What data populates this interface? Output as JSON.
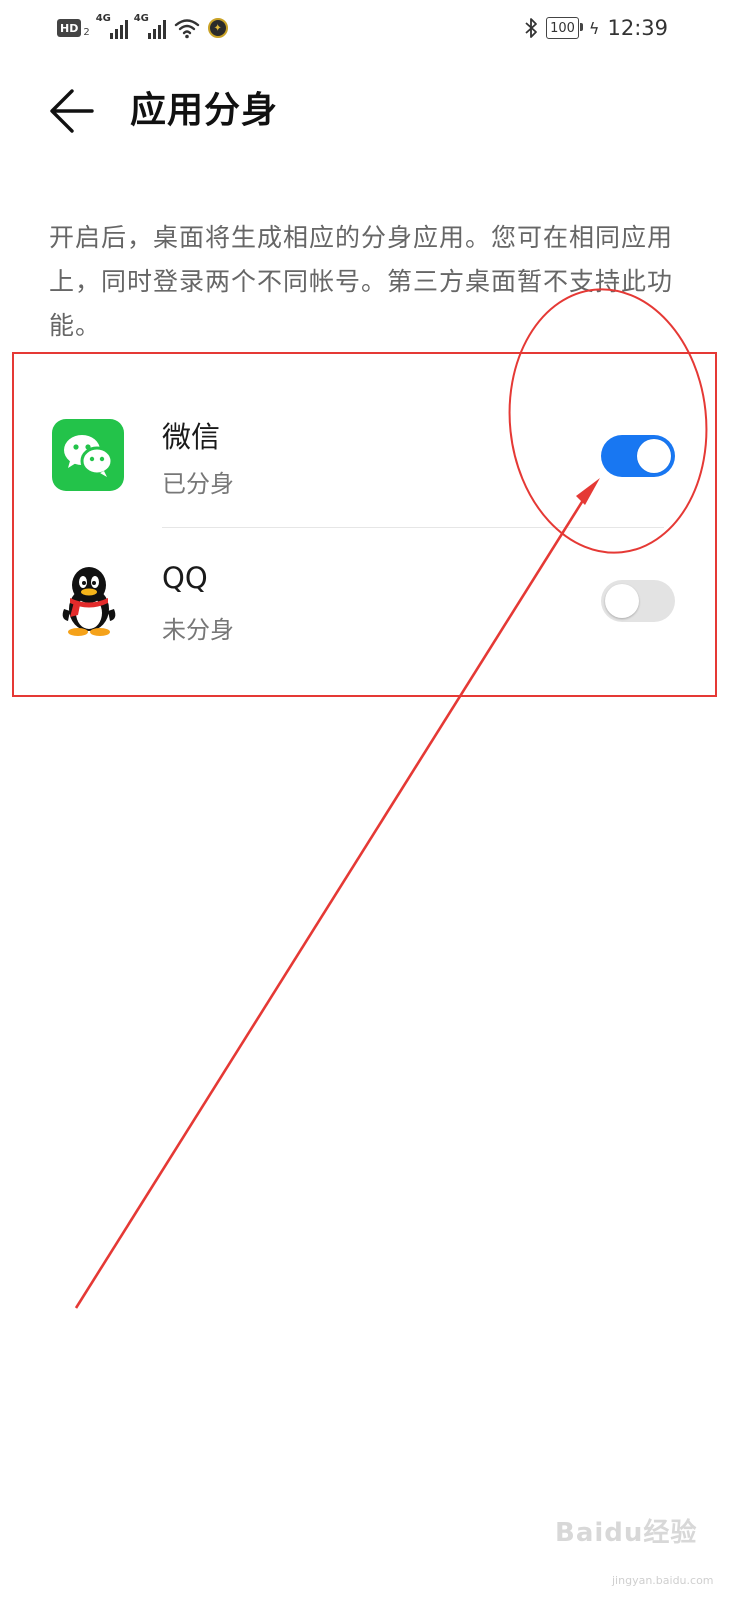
{
  "status_bar": {
    "hd_label": "HD",
    "hd_sub": "2",
    "sim1_network": "4G",
    "sim2_network": "4G",
    "battery_level": "100",
    "time": "12:39",
    "icons": [
      "hd-icon",
      "signal-icon",
      "signal-icon",
      "wifi-icon",
      "app-notification-icon",
      "bluetooth-icon",
      "battery-icon",
      "charging-icon"
    ]
  },
  "header": {
    "title": "应用分身",
    "back_icon": "back-arrow-icon"
  },
  "description": "开启后，桌面将生成相应的分身应用。您可在相同应用上，同时登录两个不同帐号。第三方桌面暂不支持此功能。",
  "apps": [
    {
      "name": "微信",
      "status": "已分身",
      "enabled": true,
      "icon": "wechat-icon",
      "toggle_color": "#1877f2"
    },
    {
      "name": "QQ",
      "status": "未分身",
      "enabled": false,
      "icon": "qq-icon",
      "toggle_color": "#e3e3e3"
    }
  ],
  "annotation_color": "#e53935",
  "watermark": {
    "text": "Baidu经验",
    "sub": "jingyan.baidu.com"
  }
}
